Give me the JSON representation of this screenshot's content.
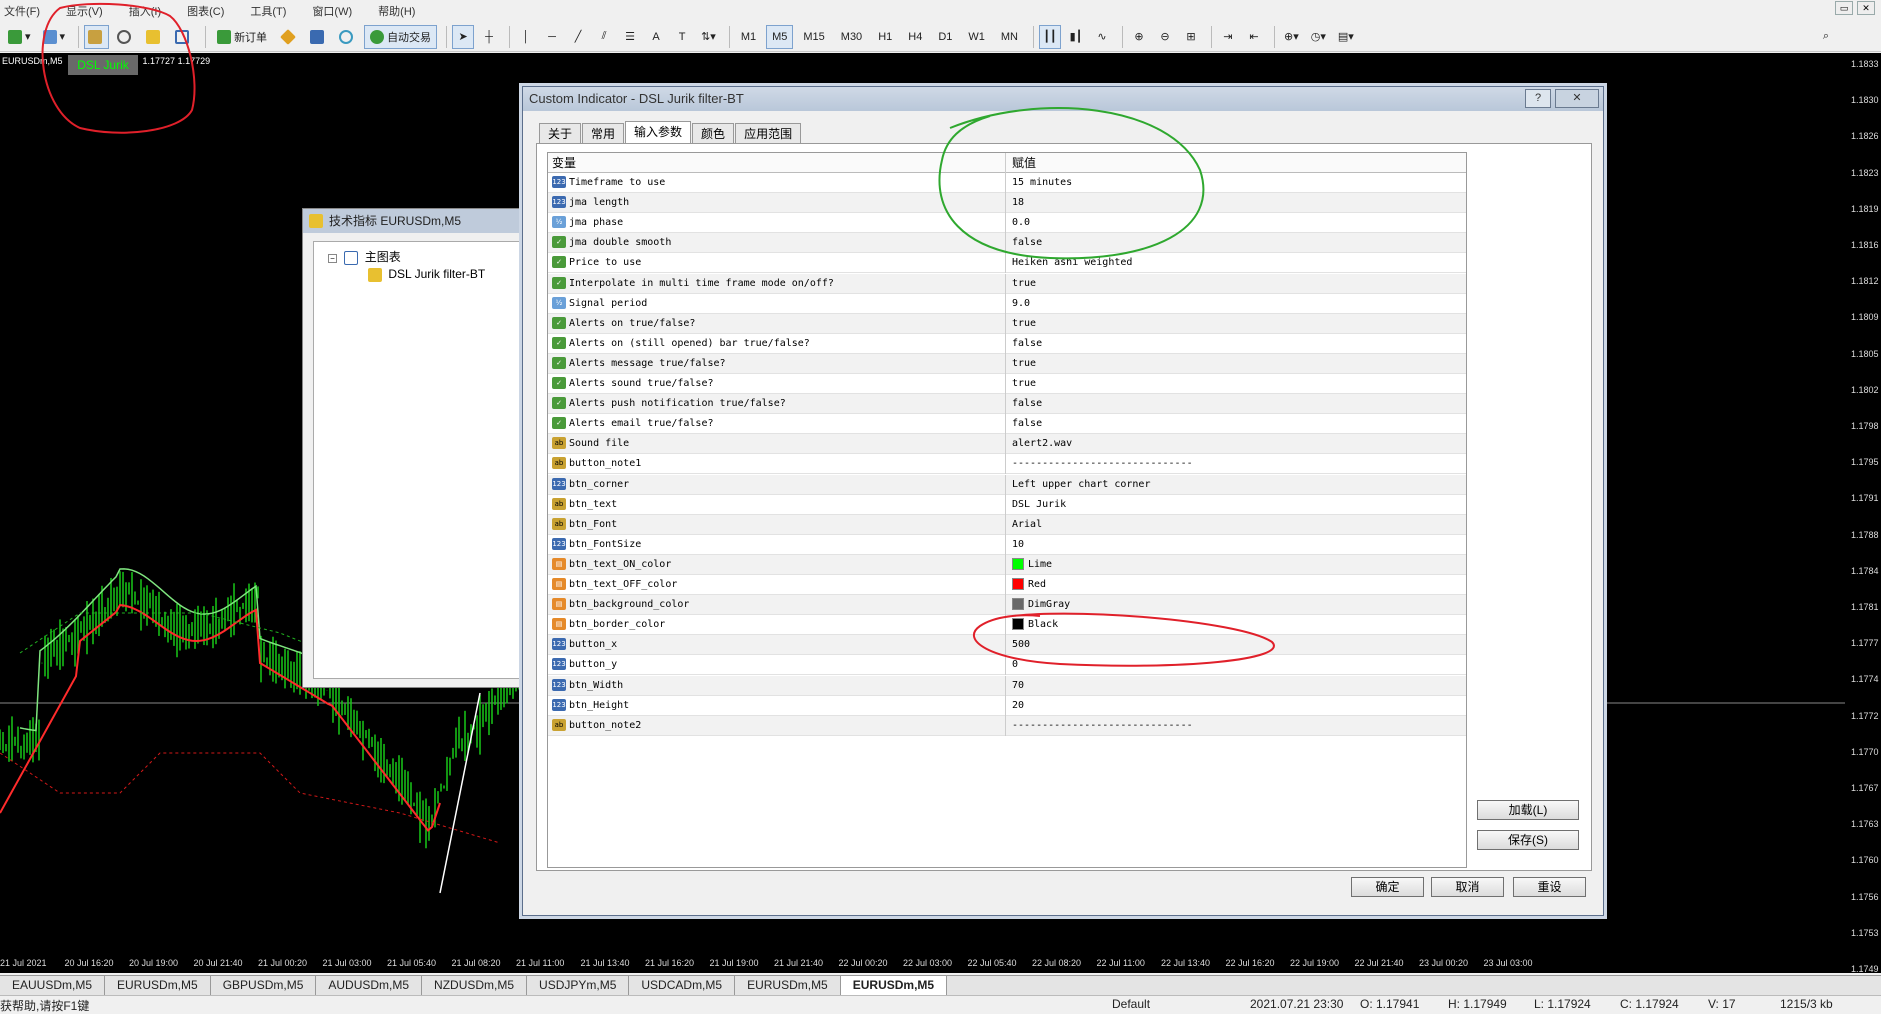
{
  "menu": [
    "文件(F)",
    "显示(V)",
    "插入(I)",
    "图表(C)",
    "工具(T)",
    "窗口(W)",
    "帮助(H)"
  ],
  "toolbar": {
    "new_order": "新订单",
    "auto_trading": "自动交易",
    "timeframes": [
      "M1",
      "M5",
      "M15",
      "M30",
      "H1",
      "H4",
      "D1",
      "W1",
      "MN"
    ],
    "selected_timeframe": "M5"
  },
  "chart": {
    "symbol_label": "EURUSDm,M5",
    "bid_ask": "1.17727 1.17729",
    "indicator_button": "DSL Jurik",
    "indicator_button_text_color": "#00ff00",
    "indicator_button_bg": "#696969",
    "price_ticks": [
      "1.1833",
      "1.1830",
      "1.1826",
      "1.1823",
      "1.1819",
      "1.1816",
      "1.1812",
      "1.1809",
      "1.1805",
      "1.1802",
      "1.1798",
      "1.1795",
      "1.1791",
      "1.1788",
      "1.1784",
      "1.1781",
      "1.1777",
      "1.1774",
      "1.1772",
      "1.1770",
      "1.1767",
      "1.1763",
      "1.1760",
      "1.1756",
      "1.1753",
      "1.1749"
    ],
    "time_ticks": [
      "21 Jul 2021",
      "20 Jul 16:20",
      "20 Jul 19:00",
      "20 Jul 21:40",
      "21 Jul 00:20",
      "21 Jul 03:00",
      "21 Jul 05:40",
      "21 Jul 08:20",
      "21 Jul 11:00",
      "21 Jul 13:40",
      "21 Jul 16:20",
      "21 Jul 19:00",
      "21 Jul 21:40",
      "22 Jul 00:20",
      "22 Jul 03:00",
      "22 Jul 05:40",
      "22 Jul 08:20",
      "22 Jul 11:00",
      "22 Jul 13:40",
      "22 Jul 16:20",
      "22 Jul 19:00",
      "22 Jul 21:40",
      "23 Jul 00:20",
      "23 Jul 03:00"
    ]
  },
  "symbol_tabs": [
    "EAUUSDm,M5",
    "EURUSDm,M5",
    "GBPUSDm,M5",
    "AUDUSDm,M5",
    "NZDUSDm,M5",
    "USDJPYm,M5",
    "USDCADm,M5",
    "EURUSDm,M5",
    "EURUSDm,M5"
  ],
  "active_symbol_tab": 8,
  "status": {
    "help": "获帮助,请按F1键",
    "profile": "Default",
    "datetime": "2021.07.21 23:30",
    "open": "O: 1.17941",
    "high": "H: 1.17949",
    "low": "L: 1.17924",
    "close": "C: 1.17924",
    "volume": "V: 17",
    "traffic": "1215/3 kb"
  },
  "navigator": {
    "title": "技术指标 EURUSDm,M5",
    "root": "主图表",
    "child": "DSL Jurik filter-BT"
  },
  "dialog": {
    "title": "Custom Indicator - DSL Jurik filter-BT",
    "help_btn": "?",
    "close_btn": "✕",
    "tabs": [
      "关于",
      "常用",
      "输入参数",
      "颜色",
      "应用范围"
    ],
    "active_tab": 2,
    "col_variable": "变量",
    "col_value": "赋值",
    "params": [
      {
        "type": "int",
        "name": "Timeframe to use",
        "value": "15 minutes"
      },
      {
        "type": "int",
        "name": "jma length",
        "value": "18"
      },
      {
        "type": "dbl",
        "name": "jma  phase",
        "value": "0.0"
      },
      {
        "type": "bool",
        "name": "jma  double smooth",
        "value": "false"
      },
      {
        "type": "bool",
        "name": "Price to use",
        "value": "Heiken ashi weighted"
      },
      {
        "type": "bool",
        "name": "Interpolate in multi time frame mode on/off?",
        "value": "true"
      },
      {
        "type": "dbl",
        "name": "Signal period",
        "value": "9.0"
      },
      {
        "type": "bool",
        "name": "Alerts on true/false?",
        "value": "true"
      },
      {
        "type": "bool",
        "name": "Alerts on (still opened) bar true/false?",
        "value": "false"
      },
      {
        "type": "bool",
        "name": "Alerts message true/false?",
        "value": "true"
      },
      {
        "type": "bool",
        "name": "Alerts sound true/false?",
        "value": "true"
      },
      {
        "type": "bool",
        "name": "Alerts push notification true/false?",
        "value": "false"
      },
      {
        "type": "bool",
        "name": "Alerts email true/false?",
        "value": "false"
      },
      {
        "type": "str",
        "name": "Sound file",
        "value": "alert2.wav"
      },
      {
        "type": "str",
        "name": "button_note1",
        "value": "------------------------------"
      },
      {
        "type": "int",
        "name": "btn_corner",
        "value": "Left upper chart corner"
      },
      {
        "type": "str",
        "name": "btn_text",
        "value": "DSL Jurik"
      },
      {
        "type": "str",
        "name": "btn_Font",
        "value": "Arial"
      },
      {
        "type": "int",
        "name": "btn_FontSize",
        "value": "10"
      },
      {
        "type": "clr",
        "name": "btn_text_ON_color",
        "value": "Lime",
        "swatch": "#00ff00"
      },
      {
        "type": "clr",
        "name": "btn_text_OFF_color",
        "value": "Red",
        "swatch": "#ff0000"
      },
      {
        "type": "clr",
        "name": "btn_background_color",
        "value": "DimGray",
        "swatch": "#696969"
      },
      {
        "type": "clr",
        "name": "btn_border_color",
        "value": "Black",
        "swatch": "#000000"
      },
      {
        "type": "int",
        "name": "button_x",
        "value": "500"
      },
      {
        "type": "int",
        "name": "button_y",
        "value": "0"
      },
      {
        "type": "int",
        "name": "btn_Width",
        "value": "70"
      },
      {
        "type": "int",
        "name": "btn_Height",
        "value": "20"
      },
      {
        "type": "str",
        "name": "button_note2",
        "value": "------------------------------"
      }
    ],
    "load_btn": "加载(L)",
    "save_btn": "保存(S)",
    "ok_btn": "确定",
    "cancel_btn": "取消",
    "reset_btn": "重设"
  },
  "annotation_colors": {
    "red": "#e0202a",
    "green": "#2fa82f"
  }
}
